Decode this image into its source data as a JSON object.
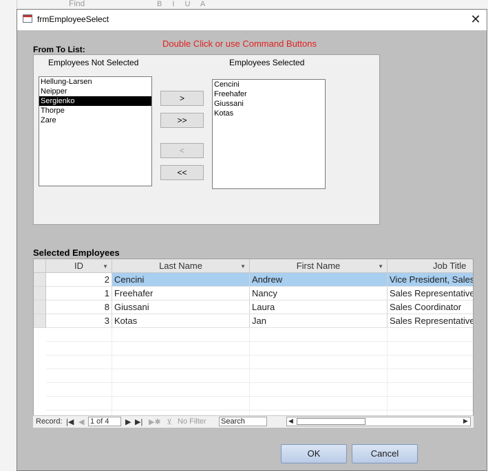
{
  "background": {
    "find_label": "Find",
    "format_glyphs": "B I U A"
  },
  "window": {
    "title": "frmEmployeeSelect",
    "close_glyph": "✕"
  },
  "hint": "Double Click or use Command Buttons",
  "from_to": {
    "label": "From To List:",
    "not_selected_header": "Employees Not Selected",
    "selected_header": "Employees Selected",
    "not_selected": [
      "Hellung-Larsen",
      "Neipper",
      "Sergienko",
      "Thorpe",
      "Zare"
    ],
    "not_selected_highlight": "Sergienko",
    "selected": [
      "Cencini",
      "Freehafer",
      "Giussani",
      "Kotas"
    ],
    "buttons": {
      "move_one": ">",
      "move_all": ">>",
      "remove_one": "<",
      "remove_all": "<<"
    }
  },
  "selected_employees": {
    "label": "Selected Employees",
    "columns": [
      "ID",
      "Last Name",
      "First Name",
      "Job Title"
    ],
    "rows": [
      {
        "id": "2",
        "last": "Cencini",
        "first": "Andrew",
        "title": "Vice President, Sales"
      },
      {
        "id": "1",
        "last": "Freehafer",
        "first": "Nancy",
        "title": "Sales Representative"
      },
      {
        "id": "8",
        "last": "Giussani",
        "first": "Laura",
        "title": "Sales Coordinator"
      },
      {
        "id": "3",
        "last": "Kotas",
        "first": "Jan",
        "title": "Sales Representative"
      }
    ]
  },
  "navigation": {
    "record_label": "Record:",
    "record_value": "1 of 4",
    "filter_label": "No Filter",
    "search_placeholder": "Search"
  },
  "footer": {
    "ok": "OK",
    "cancel": "Cancel"
  },
  "colors": {
    "hint": "#e02020",
    "row_highlight": "#a8cef0",
    "dialog_bg": "#bfbfbf"
  }
}
